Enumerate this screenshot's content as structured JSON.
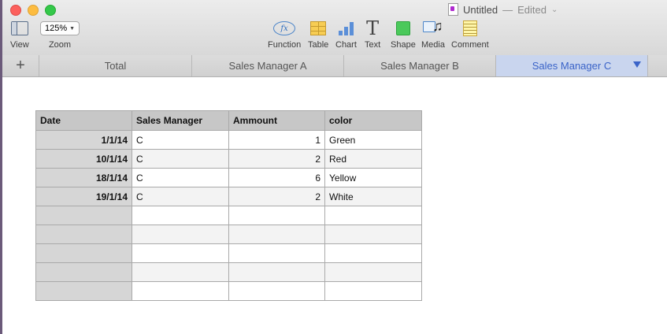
{
  "window": {
    "title": "Untitled",
    "separator": "—",
    "status": "Edited"
  },
  "toolbar": {
    "view_label": "View",
    "zoom_value": "125%",
    "zoom_label": "Zoom",
    "function_icon_text": "fx",
    "function_label": "Function",
    "table_label": "Table",
    "chart_label": "Chart",
    "text_label": "Text",
    "text_icon_glyph": "T",
    "shape_label": "Shape",
    "media_label": "Media",
    "comment_label": "Comment"
  },
  "tabs": {
    "add_glyph": "+",
    "items": [
      {
        "label": "Total"
      },
      {
        "label": "Sales Manager A"
      },
      {
        "label": "Sales Manager B"
      },
      {
        "label": "Sales Manager C",
        "active": true
      }
    ]
  },
  "table": {
    "headers": [
      "Date",
      "Sales Manager",
      "Ammount",
      "color"
    ],
    "rows": [
      [
        "1/1/14",
        "C",
        "1",
        "Green"
      ],
      [
        "10/1/14",
        "C",
        "2",
        "Red"
      ],
      [
        "18/1/14",
        "C",
        "6",
        "Yellow"
      ],
      [
        "19/1/14",
        "C",
        "2",
        "White"
      ],
      [
        "",
        "",
        "",
        ""
      ],
      [
        "",
        "",
        "",
        ""
      ],
      [
        "",
        "",
        "",
        ""
      ],
      [
        "",
        "",
        "",
        ""
      ],
      [
        "",
        "",
        "",
        ""
      ]
    ]
  },
  "colors": {
    "active_tab_bg": "#c9d5ee",
    "active_tab_text": "#3a63c8"
  }
}
